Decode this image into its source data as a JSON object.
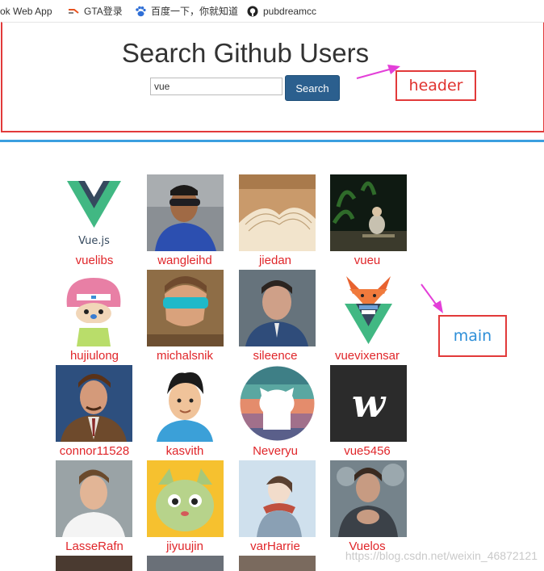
{
  "bookmarks": [
    {
      "label": "ok Web App",
      "icon": "webapp-icon"
    },
    {
      "label": "GTA登录",
      "icon": "gta-icon"
    },
    {
      "label": "百度一下，你就知道",
      "icon": "baidu-paw-icon"
    },
    {
      "label": "pubdreamcc",
      "icon": "github-icon"
    }
  ],
  "header": {
    "title": "Search Github Users",
    "search_value": "vue",
    "search_button": "Search"
  },
  "annotations": {
    "header_label": "header",
    "main_label": "main",
    "box_color": "#e23a3a",
    "arrow_color": "#e33fd8"
  },
  "users": [
    {
      "login": "vuelibs",
      "avatar": "vue-logo",
      "logo_text": "Vue.js"
    },
    {
      "login": "wangleihd",
      "avatar": "photo-man-sunglasses"
    },
    {
      "login": "jiedan",
      "avatar": "photo-open-book"
    },
    {
      "login": "vueu",
      "avatar": "photo-night-garden"
    },
    {
      "login": "hujiulong",
      "avatar": "cartoon-chopper"
    },
    {
      "login": "michalsnik",
      "avatar": "photo-man-sunglasses-beach"
    },
    {
      "login": "sileence",
      "avatar": "photo-man-portrait"
    },
    {
      "login": "vuevixensar",
      "avatar": "fox-logo"
    },
    {
      "login": "connor11528",
      "avatar": "photo-anchorman"
    },
    {
      "login": "kasvith",
      "avatar": "cartoon-boy"
    },
    {
      "login": "Neveryu",
      "avatar": "github-octocat-circle"
    },
    {
      "login": "vue5456",
      "avatar": "w-logo-dark"
    },
    {
      "login": "LasseRafn",
      "avatar": "photo-man-white-shirt"
    },
    {
      "login": "jiyuujin",
      "avatar": "cartoon-green-cat"
    },
    {
      "login": "varHarrie",
      "avatar": "illustration-girl-scarf"
    },
    {
      "login": "Vuelos",
      "avatar": "photo-man-hands"
    }
  ],
  "watermark": "https://blog.csdn.net/weixin_46872121"
}
